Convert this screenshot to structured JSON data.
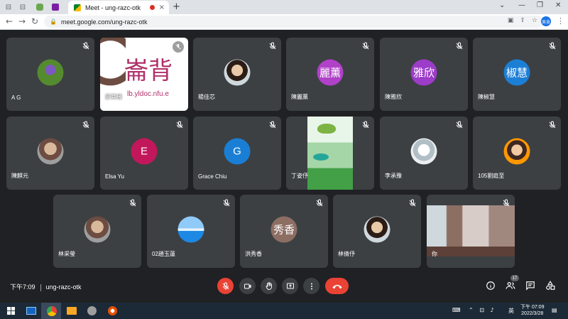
{
  "browser": {
    "tab_title": "Meet - ung-razc-otk",
    "tab_close": "×",
    "new_tab": "+",
    "url": "meet.google.com/ung-razc-otk",
    "profile_initial": "吳肯",
    "window_controls": [
      "⌄",
      "—",
      "❐",
      "✕"
    ]
  },
  "tiles_row1": [
    {
      "name": "A G",
      "kind": "photo",
      "avatar_text": ""
    },
    {
      "name": "廖其臻",
      "kind": "screen",
      "avatar_text": "崙背",
      "screen_text": "崙背",
      "screen_sub": "lb.yldoc.nfu.e"
    },
    {
      "name": "楊佳芯",
      "kind": "photo",
      "avatar_text": ""
    },
    {
      "name": "陳麗薰",
      "kind": "initials",
      "avatar_text": "麗薰",
      "color": "#b041c8"
    },
    {
      "name": "陳雅欣",
      "kind": "initials",
      "avatar_text": "雅欣",
      "color": "#9c3cc8"
    },
    {
      "name": "陳椒慧",
      "kind": "initials",
      "avatar_text": "椒慧",
      "color": "#1c7fd6"
    }
  ],
  "tiles_row2": [
    {
      "name": "陳麒元",
      "kind": "photo",
      "avatar_text": ""
    },
    {
      "name": "Elsa Yu",
      "kind": "initials",
      "avatar_text": "E",
      "color": "#c2185b"
    },
    {
      "name": "Grace Chiu",
      "kind": "initials",
      "avatar_text": "G",
      "color": "#1a7fd4"
    },
    {
      "name": "丁姿伃",
      "kind": "video",
      "avatar_text": ""
    },
    {
      "name": "李承豫",
      "kind": "photo",
      "avatar_text": ""
    },
    {
      "name": "105劉庭至",
      "kind": "photo",
      "avatar_text": ""
    }
  ],
  "tiles_row3": [
    {
      "name": "林采瑩",
      "kind": "photo",
      "avatar_text": ""
    },
    {
      "name": "02趙玉蓮",
      "kind": "photo",
      "avatar_text": ""
    },
    {
      "name": "洪秀香",
      "kind": "initials",
      "avatar_text": "秀香",
      "color": "#8d6e63"
    },
    {
      "name": "林倩伃",
      "kind": "photo",
      "avatar_text": ""
    },
    {
      "name": "你",
      "kind": "self",
      "avatar_text": ""
    }
  ],
  "meeting": {
    "time": "下午7:09",
    "code": "ung-razc-otk",
    "participants_count": "17"
  },
  "taskbar": {
    "clock_time": "下午 07:09",
    "clock_date": "2022/3/28",
    "ime": "英",
    "tray_icons": "⌃ ⊡ ♪"
  },
  "colors": {
    "bg": "#202124",
    "tile": "#3c4043",
    "danger": "#ea4335"
  }
}
